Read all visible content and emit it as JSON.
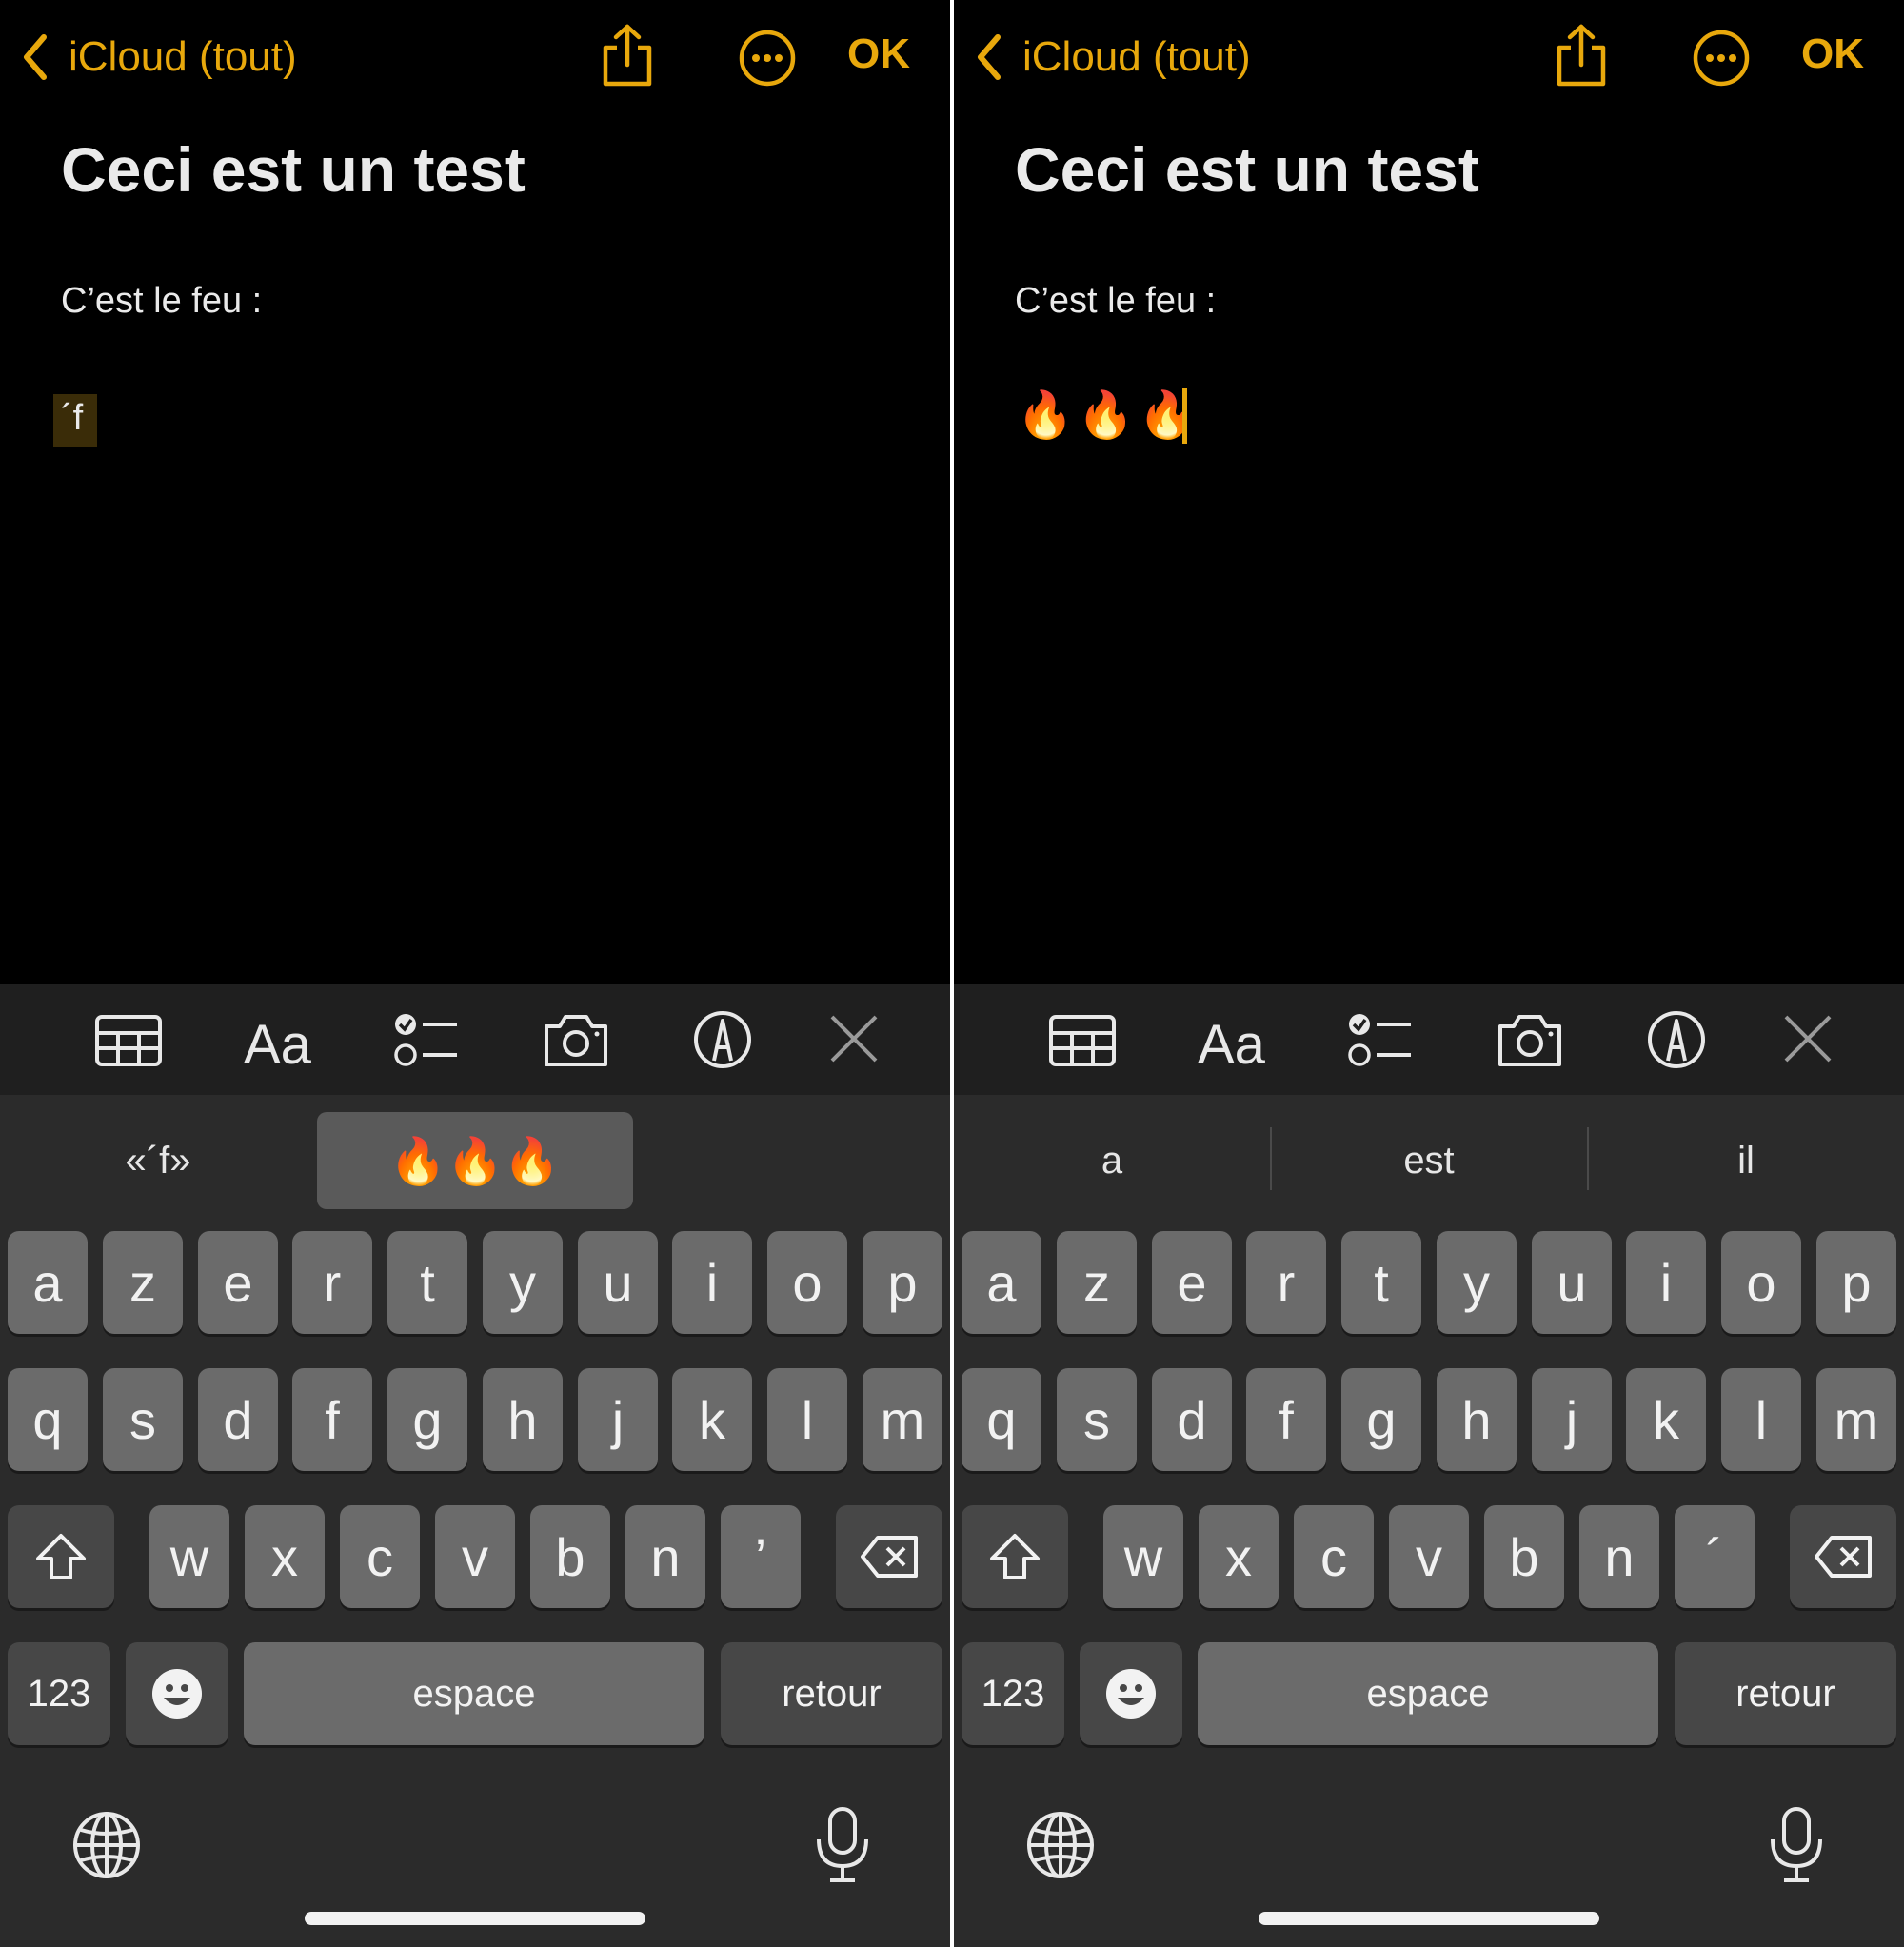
{
  "screens": [
    {
      "nav": {
        "back_label": "iCloud (tout)",
        "ok_label": "OK"
      },
      "note": {
        "title": "Ceci est un test",
        "body": "C’est le feu :",
        "marked_text": "´f"
      },
      "toolbar": {
        "format_label": "Aa"
      },
      "keyboard": {
        "suggestions": [
          "«´f»",
          "🔥🔥🔥"
        ],
        "row1": [
          "a",
          "z",
          "e",
          "r",
          "t",
          "y",
          "u",
          "i",
          "o",
          "p"
        ],
        "row2": [
          "q",
          "s",
          "d",
          "f",
          "g",
          "h",
          "j",
          "k",
          "l",
          "m"
        ],
        "row3": [
          "w",
          "x",
          "c",
          "v",
          "b",
          "n",
          "’"
        ],
        "numbers_label": "123",
        "space_label": "espace",
        "return_label": "retour"
      }
    },
    {
      "nav": {
        "back_label": "iCloud (tout)",
        "ok_label": "OK"
      },
      "note": {
        "title": "Ceci est un test",
        "body": "C’est le feu :",
        "emoji_text": "🔥🔥🔥"
      },
      "toolbar": {
        "format_label": "Aa"
      },
      "keyboard": {
        "suggestions": [
          "a",
          "est",
          "il"
        ],
        "row1": [
          "a",
          "z",
          "e",
          "r",
          "t",
          "y",
          "u",
          "i",
          "o",
          "p"
        ],
        "row2": [
          "q",
          "s",
          "d",
          "f",
          "g",
          "h",
          "j",
          "k",
          "l",
          "m"
        ],
        "row3": [
          "w",
          "x",
          "c",
          "v",
          "b",
          "n",
          "´"
        ],
        "numbers_label": "123",
        "space_label": "espace",
        "return_label": "retour"
      }
    }
  ],
  "colors": {
    "accent": "#e8a80c",
    "background": "#000000",
    "keyboard_bg": "#2b2b2b",
    "key": "#6b6b6b",
    "key_dark": "#474747"
  },
  "icons": [
    "chevron-left-icon",
    "share-icon",
    "more-icon",
    "table-icon",
    "checklist-icon",
    "camera-icon",
    "markup-icon",
    "close-icon",
    "shift-icon",
    "backspace-icon",
    "emoji-icon",
    "globe-icon",
    "microphone-icon"
  ]
}
